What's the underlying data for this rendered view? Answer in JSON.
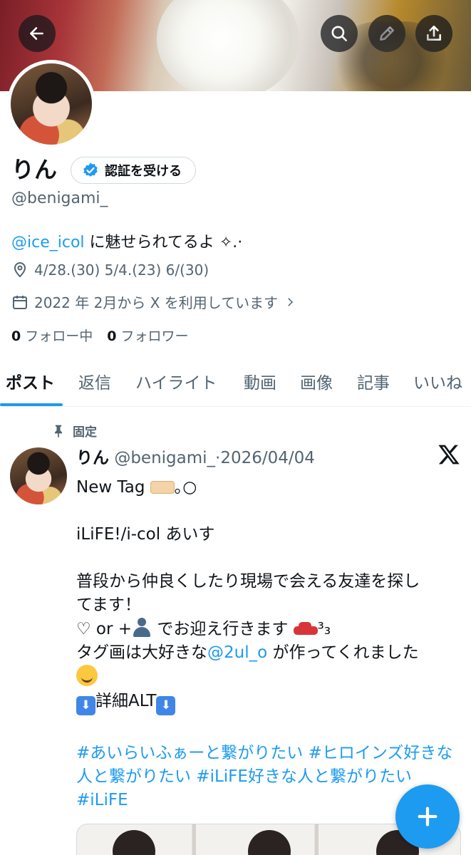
{
  "profile": {
    "name": "りん",
    "verify_label": "認証を受ける",
    "handle": "@benigami_",
    "bio_mention": "@ice_icol",
    "bio_text": " に魅せられてるよ ✧.·",
    "location": "4/28.(30) 5/4.(23) 6/(30)",
    "joined": "2022 年 2月から X を利用しています",
    "following_count": "0",
    "following_label": "フォロー中",
    "followers_count": "0",
    "followers_label": "フォロワー"
  },
  "tabs": [
    "ポスト",
    "返信",
    "ハイライト",
    "動画",
    "画像",
    "記事",
    "いいね"
  ],
  "active_tab": "ポスト",
  "post": {
    "pinned_label": "固定",
    "author_name": "りん",
    "author_handle": "@benigami_",
    "separator": "·",
    "date": "2026/04/04",
    "line1": "New Tag",
    "line1_suffix": "｡○",
    "line2": "iLiFE!/i-col あいす",
    "line3a": "普段から仲良くしたり現場で会える友達を探し",
    "line3b": "てます！",
    "line4a": "♡ or +",
    "line4b": " でお迎え行きます",
    "line4c": "³₃",
    "line5a": "タグ画は大好きな",
    "line5_mention": "@2ul_o",
    "line5b": " が作ってくれました",
    "line6a": "⬇",
    "line6b": "詳細ALT",
    "line6c": "⬇",
    "hashtags": "#あいらいふぁーと繋がりたい  #ヒロインズ好きな人と繋がりたい  #iLiFE好きな人と繋がりたい  #iLiFE"
  },
  "colors": {
    "accent": "#1d9bf0",
    "text": "#0f1419",
    "secondary": "#536471"
  },
  "icons": [
    "back-arrow-icon",
    "search-icon",
    "edit-pencil-icon",
    "share-icon",
    "verified-badge-icon",
    "location-pin-icon",
    "calendar-icon",
    "chevron-right-icon",
    "pin-icon",
    "x-logo-icon",
    "plus-icon"
  ]
}
